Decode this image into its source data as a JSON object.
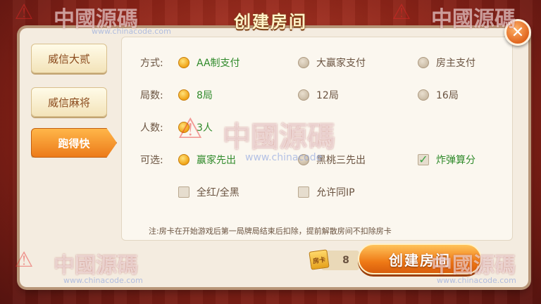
{
  "dialog": {
    "title": "创建房间",
    "close_glyph": "✕"
  },
  "side_tabs": [
    {
      "label": "威信大贰",
      "active": false
    },
    {
      "label": "威信麻将",
      "active": false
    },
    {
      "label": "跑得快",
      "active": true
    }
  ],
  "rows": {
    "mode": {
      "label": "方式:",
      "options": [
        {
          "label": "AA制支付",
          "selected": true
        },
        {
          "label": "大赢家支付",
          "selected": false
        },
        {
          "label": "房主支付",
          "selected": false
        }
      ]
    },
    "rounds": {
      "label": "局数:",
      "options": [
        {
          "label": "8局",
          "selected": true
        },
        {
          "label": "12局",
          "selected": false
        },
        {
          "label": "16局",
          "selected": false
        }
      ]
    },
    "players": {
      "label": "人数:",
      "options": [
        {
          "label": "3人",
          "selected": true
        }
      ]
    },
    "optional": {
      "label": "可选:",
      "options": [
        {
          "label": "赢家先出",
          "selected": true
        },
        {
          "label": "黑桃三先出",
          "selected": false
        }
      ],
      "checks": [
        {
          "label": "炸弹算分",
          "checked": true
        },
        {
          "label": "全红/全黑",
          "checked": false
        },
        {
          "label": "允许同IP",
          "checked": false
        }
      ]
    }
  },
  "note": "注:房卡在开始游戏后第一局牌局结束后扣除，提前解散房间不扣除房卡",
  "footer": {
    "card_icon_text": "房卡",
    "card_count": "8",
    "create_button": "创建房间"
  },
  "watermark": {
    "text": "中國源碼",
    "url": "www.chinacode.com",
    "short_url": "www.chinacode"
  },
  "colors": {
    "selected_text": "#2f8a2a",
    "accent": "#ef7a16",
    "panel": "#fbf7ef"
  }
}
